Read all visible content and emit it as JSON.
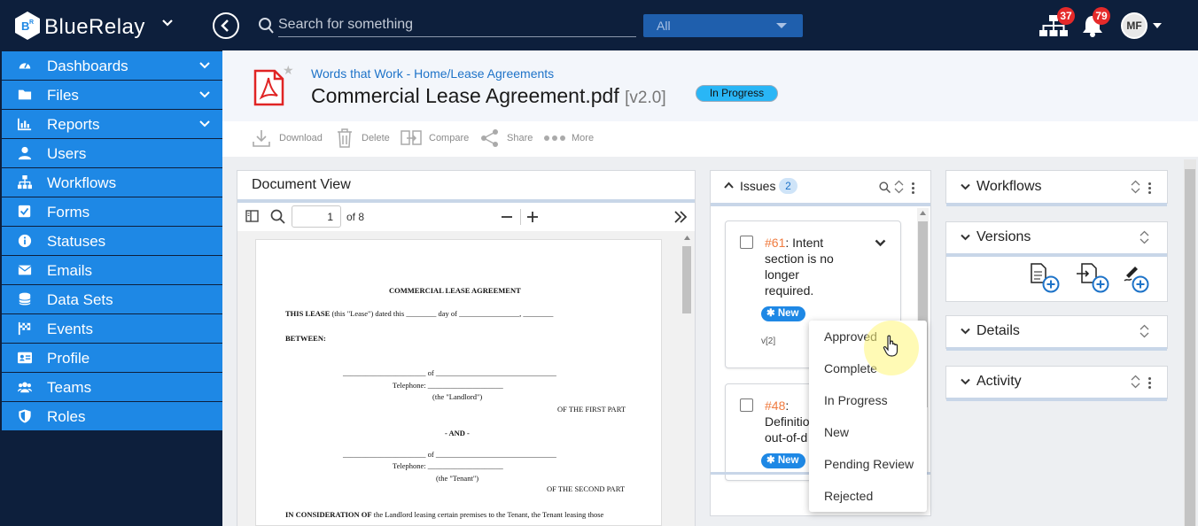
{
  "app": {
    "brand": "BlueRelay",
    "search_placeholder": "Search for something",
    "scope": "All",
    "org_badge": "37",
    "notif_badge": "79",
    "user_initials": "MF"
  },
  "sidebar": {
    "items": [
      {
        "label": "Dashboards",
        "icon": "dashboard-icon",
        "expandable": true
      },
      {
        "label": "Files",
        "icon": "folder-icon",
        "expandable": true
      },
      {
        "label": "Reports",
        "icon": "bar-chart-icon",
        "expandable": true
      },
      {
        "label": "Users",
        "icon": "user-icon",
        "expandable": false
      },
      {
        "label": "Workflows",
        "icon": "sitemap-icon",
        "expandable": false
      },
      {
        "label": "Forms",
        "icon": "check-square-icon",
        "expandable": false
      },
      {
        "label": "Statuses",
        "icon": "info-icon",
        "expandable": false
      },
      {
        "label": "Emails",
        "icon": "envelope-icon",
        "expandable": false
      },
      {
        "label": "Data Sets",
        "icon": "database-icon",
        "expandable": false
      },
      {
        "label": "Events",
        "icon": "flag-icon",
        "expandable": false
      },
      {
        "label": "Profile",
        "icon": "id-card-icon",
        "expandable": false
      },
      {
        "label": "Teams",
        "icon": "users-icon",
        "expandable": false
      },
      {
        "label": "Roles",
        "icon": "shield-icon",
        "expandable": false
      }
    ]
  },
  "document": {
    "breadcrumb": "Words that Work - Home/Lease Agreements",
    "title": "Commercial Lease Agreement.pdf",
    "version": "[v2.0]",
    "status": "In Progress"
  },
  "toolbar": {
    "download": "Download",
    "delete": "Delete",
    "compare": "Compare",
    "share": "Share",
    "more": "More"
  },
  "docview": {
    "title": "Document View",
    "page": "1",
    "of_pages": "of 8",
    "pdf_lines": {
      "heading": "COMMERCIAL LEASE AGREEMENT",
      "lease_line_bold": "THIS LEASE",
      "lease_line_rest": " (this \"Lease\") dated this ________ day of ________________, ________",
      "between": "BETWEEN:",
      "landlord_line": "______________________ of ________________________________",
      "landlord_phone": "Telephone: ____________________",
      "landlord_label": "(the \"Landlord\")",
      "first_part": "OF THE FIRST PART",
      "and": "- AND -",
      "tenant_line": "______________________ of ________________________________",
      "tenant_phone": "Telephone: ____________________",
      "tenant_label": "(the \"Tenant\")",
      "second_part": "OF THE SECOND PART",
      "consideration_bold": "IN CONSIDERATION OF",
      "consideration_rest": " the Landlord leasing certain premises to the Tenant, the Tenant leasing those"
    }
  },
  "issues": {
    "title": "Issues",
    "count": "2",
    "items": [
      {
        "number": "#61",
        "text_lines": [
          ": Intent",
          "section is no",
          "longer",
          "required."
        ],
        "badge": "New",
        "version": "v[2]"
      },
      {
        "number": "#48",
        "text_lines": [
          ":",
          "Definitio",
          "out-of-d"
        ],
        "badge": "New"
      }
    ],
    "status_menu": [
      "Approved",
      "Complete",
      "In Progress",
      "New",
      "Pending Review",
      "Rejected"
    ]
  },
  "right_panels": {
    "workflows": "Workflows",
    "versions": "Versions",
    "details": "Details",
    "activity": "Activity"
  }
}
